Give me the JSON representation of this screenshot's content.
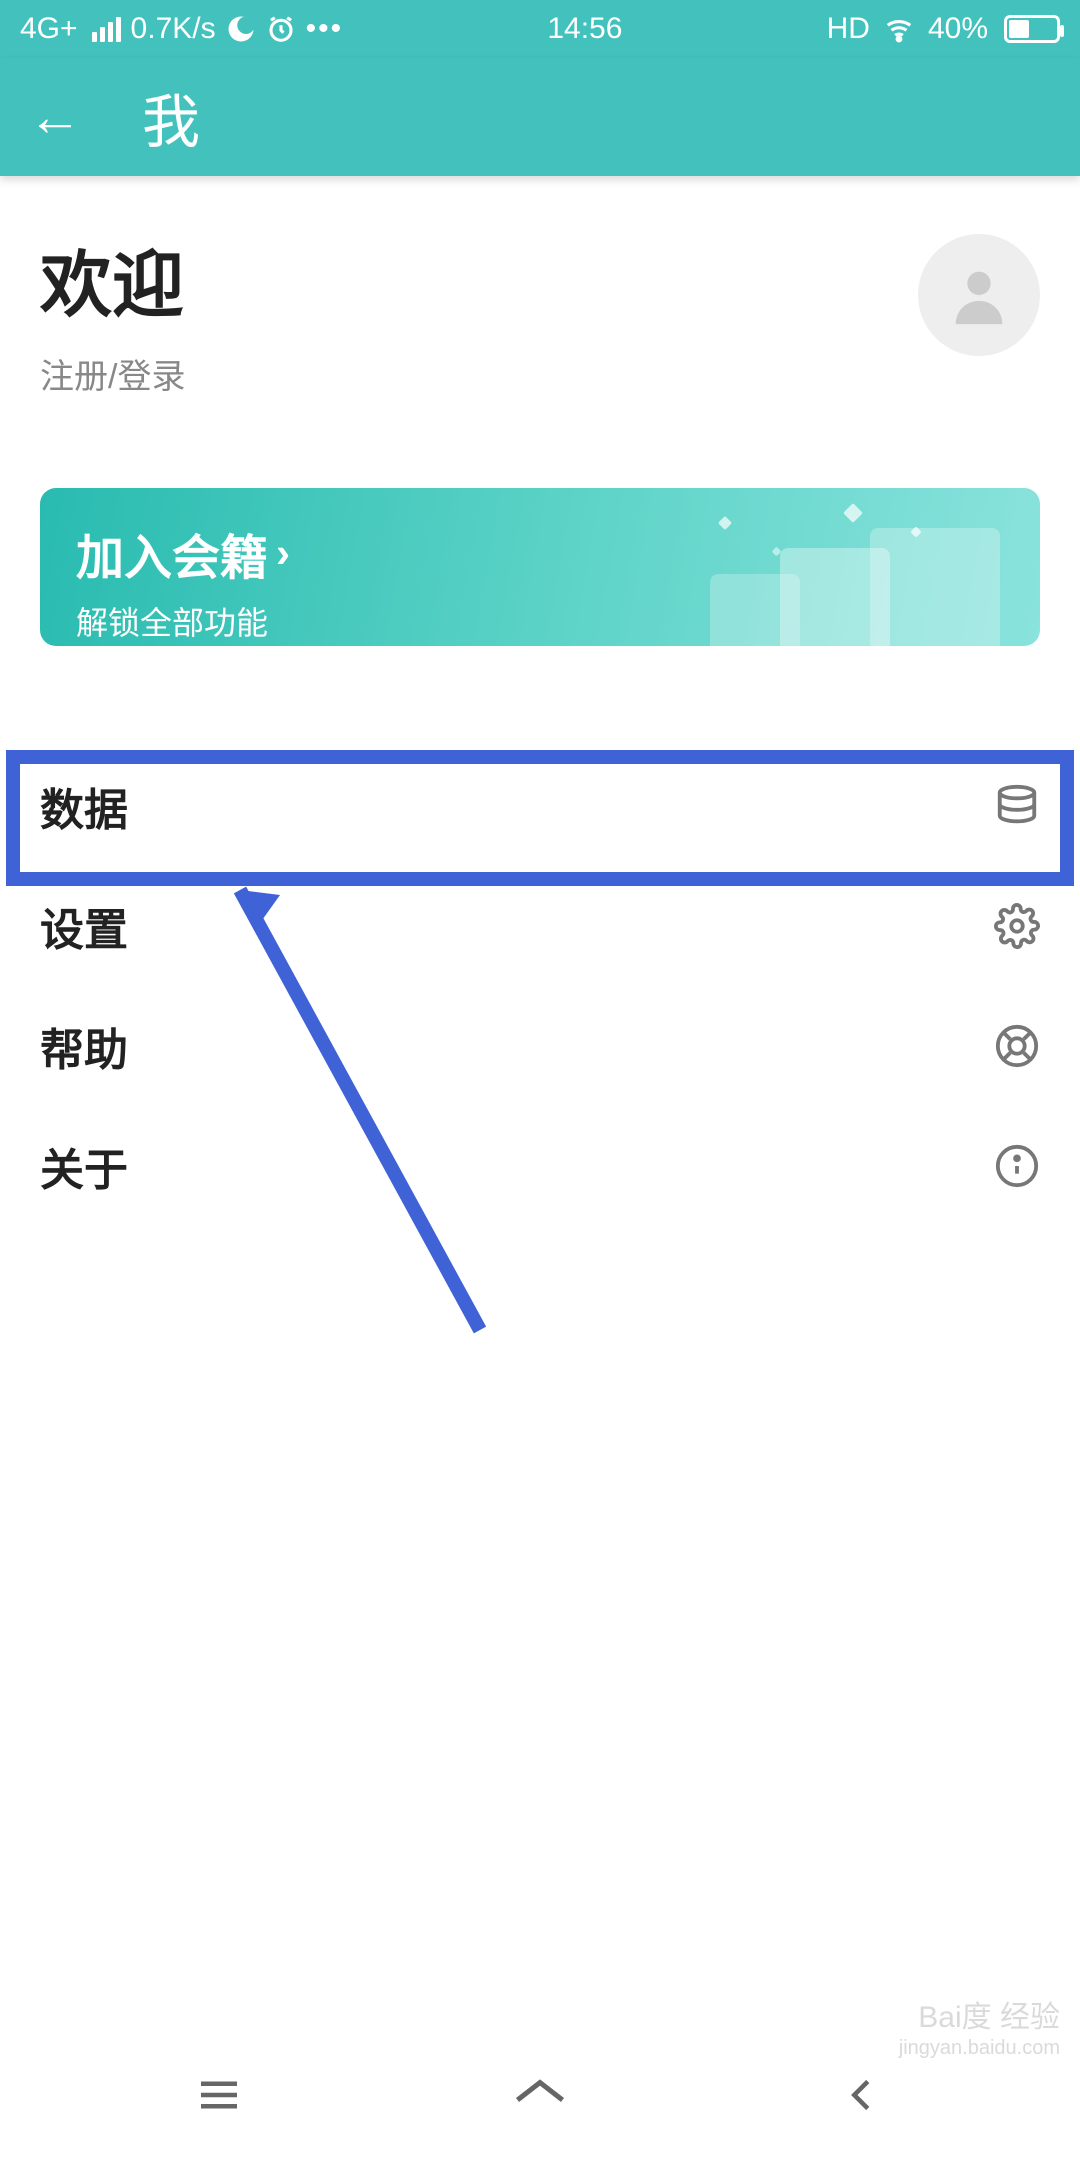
{
  "status": {
    "network": "4G+",
    "speed": "0.7K/s",
    "time": "14:56",
    "hd": "HD",
    "battery_percent": "40%"
  },
  "header": {
    "title": "我"
  },
  "profile": {
    "welcome": "欢迎",
    "login_text": "注册/登录"
  },
  "membership": {
    "title": "加入会籍",
    "subtitle": "解锁全部功能"
  },
  "menu": {
    "data": "数据",
    "settings": "设置",
    "help": "帮助",
    "about": "关于"
  },
  "watermark": {
    "brand": "Bai度 经验",
    "url": "jingyan.baidu.com"
  }
}
